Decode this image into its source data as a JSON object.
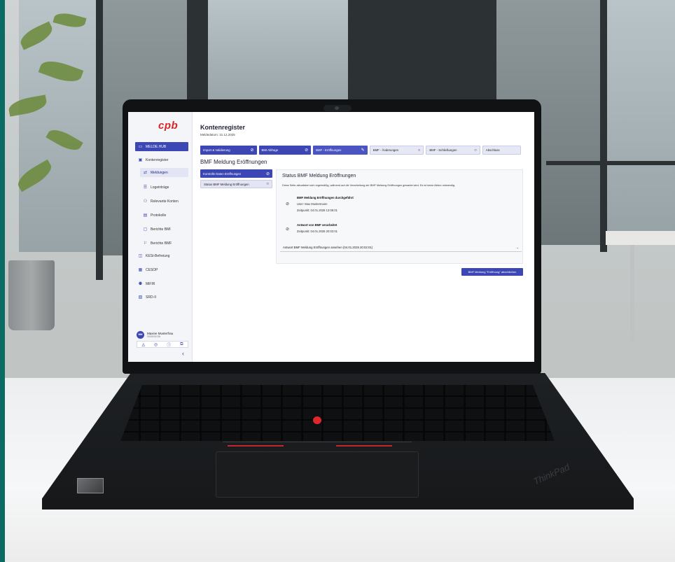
{
  "app": {
    "logo": "cpb",
    "title": "Kontenregister",
    "report_date": "Meldedatum: 31.12.2025"
  },
  "sidebar": {
    "items": [
      {
        "label": "MELDE.HUB",
        "icon": "monitor-icon",
        "state": "active"
      },
      {
        "label": "Kontenregister",
        "icon": "register-icon",
        "state": "normal"
      },
      {
        "label": "Meldungen",
        "icon": "swap-icon",
        "state": "sub-active"
      },
      {
        "label": "Logeinträge",
        "icon": "list-icon",
        "state": "sub"
      },
      {
        "label": "Relevante Konten",
        "icon": "accounts-icon",
        "state": "sub"
      },
      {
        "label": "Protokolle",
        "icon": "document-icon",
        "state": "sub"
      },
      {
        "label": "Berichte BMI",
        "icon": "report-icon",
        "state": "sub"
      },
      {
        "label": "Berichte BMF",
        "icon": "flag-icon",
        "state": "sub"
      },
      {
        "label": "KESt-Befreiung",
        "icon": "exemption-icon",
        "state": "normal"
      },
      {
        "label": "CESOP",
        "icon": "cesop-icon",
        "state": "normal"
      },
      {
        "label": "MiFIR",
        "icon": "people-icon",
        "state": "normal"
      },
      {
        "label": "SRD-II",
        "icon": "srd-icon",
        "state": "normal"
      }
    ],
    "user": {
      "initials": "MM",
      "name": "Maxine Musterfrau",
      "id": "000000102k"
    },
    "tools": [
      "◬",
      "◎",
      "ⓘ",
      "⧉"
    ],
    "collapse": "‹"
  },
  "steps": [
    {
      "label": "Import & Validierung",
      "icon": "check-circle-icon",
      "glyph": "⊘",
      "state": "done"
    },
    {
      "label": "BMI Abfrage",
      "icon": "check-circle-icon",
      "glyph": "⊘",
      "state": "done"
    },
    {
      "label": "BMF - Eröffnungen",
      "icon": "pencil-icon",
      "glyph": "✎",
      "state": "current"
    },
    {
      "label": "BMF - Änderungen",
      "icon": "circle-icon",
      "glyph": "○",
      "state": "todo"
    },
    {
      "label": "BMF - Schließungen",
      "icon": "circle-icon",
      "glyph": "○",
      "state": "todo"
    },
    {
      "label": "Abschluss",
      "icon": "",
      "glyph": "",
      "state": "todo"
    }
  ],
  "section_title": "BMF Meldung Eröffnungen",
  "substeps": [
    {
      "label": "Kontrolle Daten Eröffnungen",
      "glyph": "⊘",
      "state": "done"
    },
    {
      "label": "Status BMF Meldung Eröffnungen",
      "glyph": "○",
      "state": "current"
    }
  ],
  "panel": {
    "title": "Status BMF Meldung Eröffnungen",
    "description": "Diese Seite aktualisiert sich regelmäßig, während auf die Verarbeitung der BMF Meldung Eröffnungen gewartet wird. Es ist keine Aktion notwendig.",
    "events": [
      {
        "title": "BMF Meldung Eröffnungen durchgeführt",
        "user": "User: Max Mustermann",
        "time": "Zeitpunkt: 04.01.2026 13:05:01"
      },
      {
        "title": "Antwort von BMF verarbeitet",
        "time": "Zeitpunkt: 04.01.2026 20:02:01"
      }
    ],
    "accordion": "Antwort BMF Meldung Eröffnungen ansehen   (04.01.2026 20:02:01)"
  },
  "finish_button": "BMF Meldung \"Eröffnung\" abschließen",
  "colors": {
    "primary": "#3c46b4",
    "logo_red": "#d8262b",
    "sidebar_bg": "#f4f5f8"
  }
}
